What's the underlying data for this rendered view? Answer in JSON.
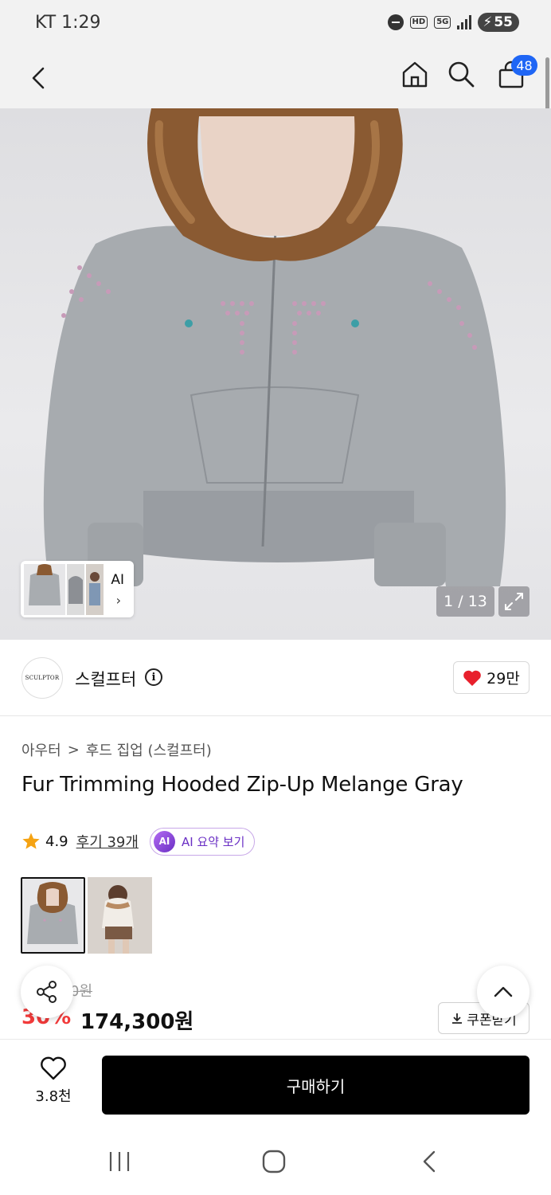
{
  "status_bar": {
    "time": "KT 1:29",
    "hd": "HD",
    "network": "5G",
    "battery": "55"
  },
  "header": {
    "cart_count": "48"
  },
  "gallery": {
    "counter": "1 / 13",
    "ai_thumb_label": "AI"
  },
  "brand": {
    "logo_text": "SCULPTOR",
    "name": "스컬프터",
    "like_count": "29만"
  },
  "breadcrumb": {
    "category": "아우터",
    "separator": ">",
    "subcategory": "후드 집업 (스컬프터)"
  },
  "product": {
    "title": "Fur Trimming Hooded Zip-Up Melange Gray",
    "rating": "4.9",
    "reviews": "후기 39개",
    "ai_icon": "AI",
    "ai_summary": "AI 요약 보기"
  },
  "price": {
    "original_visible": "0원",
    "discount_visible": "30%",
    "final": "174,300원",
    "coupon_label": "쿠폰받기"
  },
  "bottom": {
    "wish_count": "3.8천",
    "buy_label": "구매하기"
  },
  "colors": {
    "brand_accent": "#1f66f5",
    "discount_red": "#f23a3a",
    "heart_red": "#e8202c",
    "ai_purple": "#6a2fc4"
  }
}
